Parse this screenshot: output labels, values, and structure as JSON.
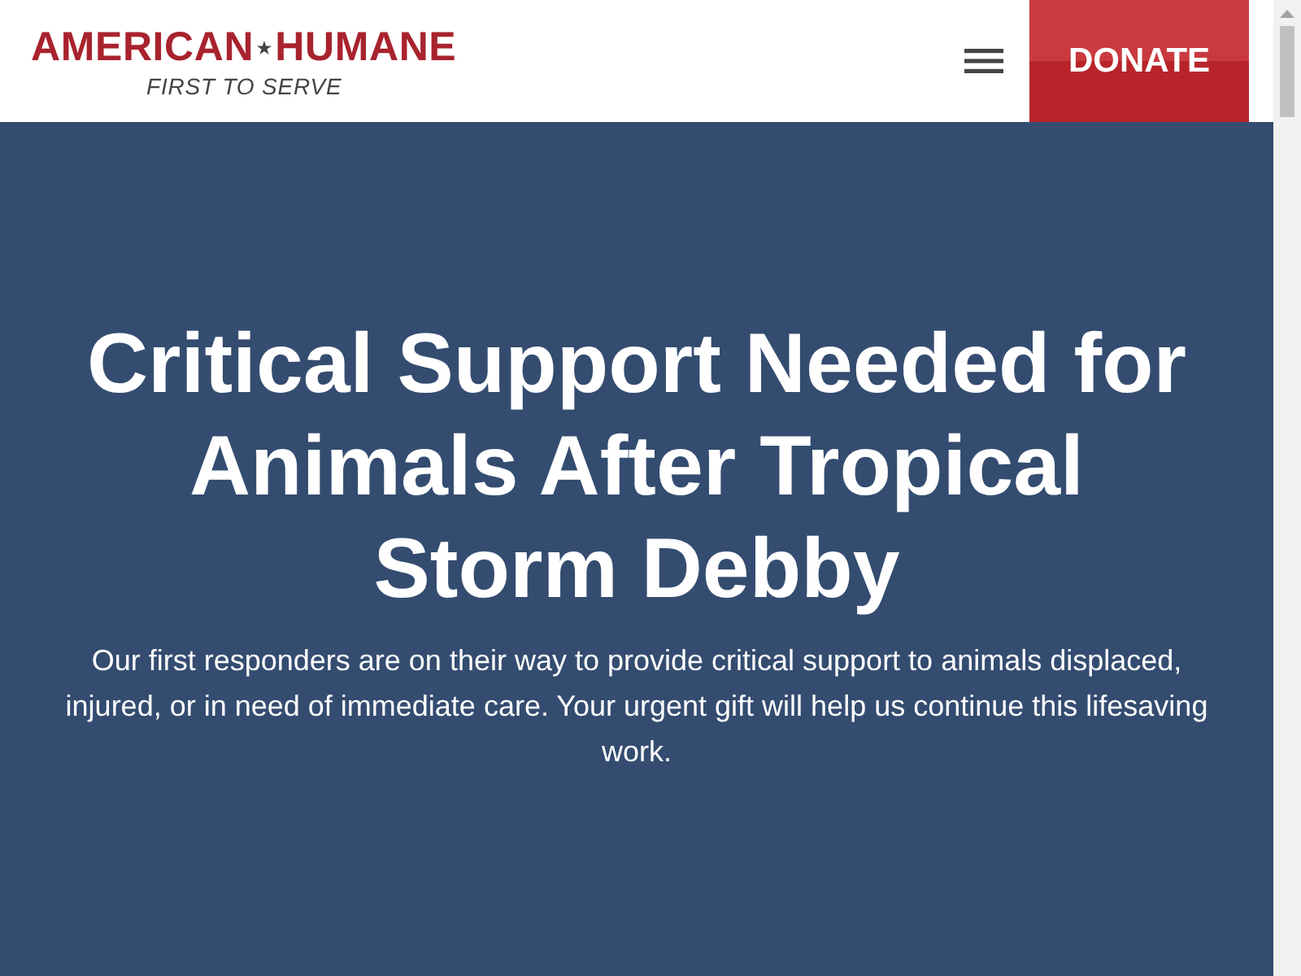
{
  "header": {
    "logo": {
      "name_left": "AMERICAN",
      "name_right": "HUMANE",
      "tagline": "FIRST TO SERVE"
    },
    "donate_button": {
      "label": "DONATE"
    }
  },
  "hero": {
    "title": "Critical Support Needed for Animals After Tropical Storm Debby",
    "text": "Our first responders are on their way to provide critical support to animals displaced, injured, or in need of immediate care. Your urgent gift will help us continue this lifesaving work."
  }
}
